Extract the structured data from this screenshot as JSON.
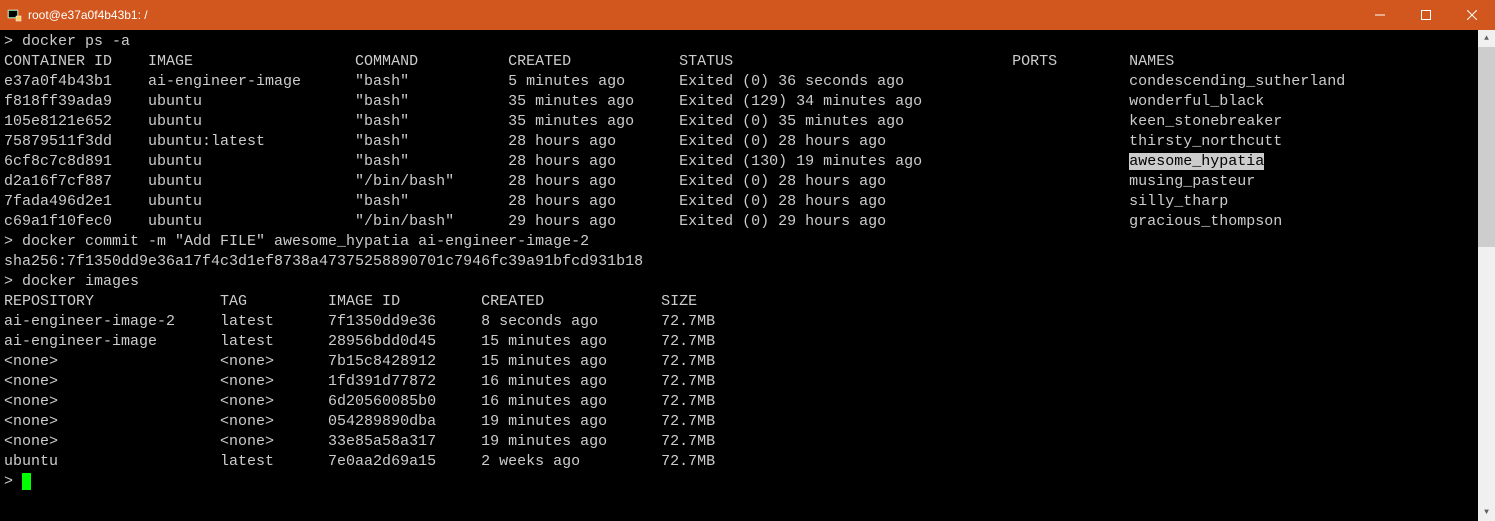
{
  "window": {
    "title": "root@e37a0f4b43b1: /"
  },
  "commands": {
    "cmd1": "> docker ps -a",
    "cmd2": "> docker commit -m \"Add FILE\" awesome_hypatia ai-engineer-image-2",
    "cmd2_output": "sha256:7f1350dd9e36a17f4c3d1ef8738a47375258890701c7946fc39a91bfcd931b18",
    "cmd3": "> docker images",
    "prompt": "> "
  },
  "ps_header": {
    "container_id": "CONTAINER ID",
    "image": "IMAGE",
    "command": "COMMAND",
    "created": "CREATED",
    "status": "STATUS",
    "ports": "PORTS",
    "names": "NAMES"
  },
  "ps_rows": [
    {
      "id": "e37a0f4b43b1",
      "image": "ai-engineer-image",
      "command": "\"bash\"",
      "created": "5 minutes ago",
      "status": "Exited (0) 36 seconds ago",
      "names": "condescending_sutherland"
    },
    {
      "id": "f818ff39ada9",
      "image": "ubuntu",
      "command": "\"bash\"",
      "created": "35 minutes ago",
      "status": "Exited (129) 34 minutes ago",
      "names": "wonderful_black"
    },
    {
      "id": "105e8121e652",
      "image": "ubuntu",
      "command": "\"bash\"",
      "created": "35 minutes ago",
      "status": "Exited (0) 35 minutes ago",
      "names": "keen_stonebreaker"
    },
    {
      "id": "75879511f3dd",
      "image": "ubuntu:latest",
      "command": "\"bash\"",
      "created": "28 hours ago",
      "status": "Exited (0) 28 hours ago",
      "names": "thirsty_northcutt"
    },
    {
      "id": "6cf8c7c8d891",
      "image": "ubuntu",
      "command": "\"bash\"",
      "created": "28 hours ago",
      "status": "Exited (130) 19 minutes ago",
      "names": "awesome_hypatia"
    },
    {
      "id": "d2a16f7cf887",
      "image": "ubuntu",
      "command": "\"/bin/bash\"",
      "created": "28 hours ago",
      "status": "Exited (0) 28 hours ago",
      "names": "musing_pasteur"
    },
    {
      "id": "7fada496d2e1",
      "image": "ubuntu",
      "command": "\"bash\"",
      "created": "28 hours ago",
      "status": "Exited (0) 28 hours ago",
      "names": "silly_tharp"
    },
    {
      "id": "c69a1f10fec0",
      "image": "ubuntu",
      "command": "\"/bin/bash\"",
      "created": "29 hours ago",
      "status": "Exited (0) 29 hours ago",
      "names": "gracious_thompson"
    }
  ],
  "images_header": {
    "repository": "REPOSITORY",
    "tag": "TAG",
    "image_id": "IMAGE ID",
    "created": "CREATED",
    "size": "SIZE"
  },
  "images_rows": [
    {
      "repo": "ai-engineer-image-2",
      "tag": "latest",
      "id": "7f1350dd9e36",
      "created": "8 seconds ago",
      "size": "72.7MB"
    },
    {
      "repo": "ai-engineer-image",
      "tag": "latest",
      "id": "28956bdd0d45",
      "created": "15 minutes ago",
      "size": "72.7MB"
    },
    {
      "repo": "<none>",
      "tag": "<none>",
      "id": "7b15c8428912",
      "created": "15 minutes ago",
      "size": "72.7MB"
    },
    {
      "repo": "<none>",
      "tag": "<none>",
      "id": "1fd391d77872",
      "created": "16 minutes ago",
      "size": "72.7MB"
    },
    {
      "repo": "<none>",
      "tag": "<none>",
      "id": "6d20560085b0",
      "created": "16 minutes ago",
      "size": "72.7MB"
    },
    {
      "repo": "<none>",
      "tag": "<none>",
      "id": "054289890dba",
      "created": "19 minutes ago",
      "size": "72.7MB"
    },
    {
      "repo": "<none>",
      "tag": "<none>",
      "id": "33e85a58a317",
      "created": "19 minutes ago",
      "size": "72.7MB"
    },
    {
      "repo": "ubuntu",
      "tag": "latest",
      "id": "7e0aa2d69a15",
      "created": "2 weeks ago",
      "size": "72.7MB"
    }
  ],
  "highlighted_name": "awesome_hypatia"
}
